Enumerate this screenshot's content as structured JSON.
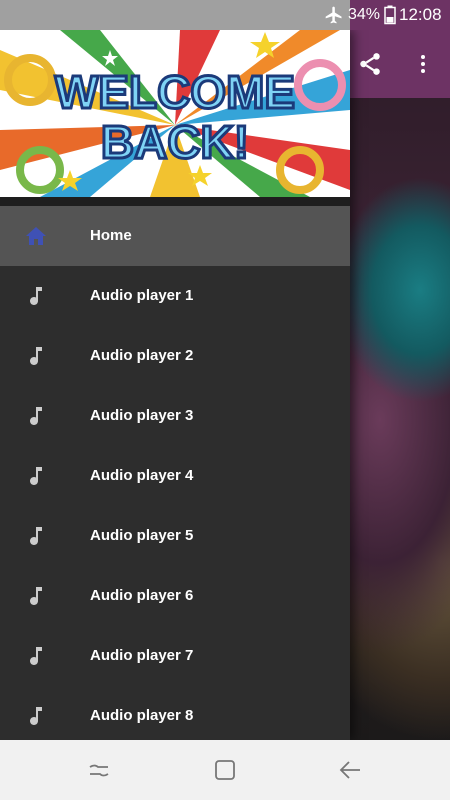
{
  "status_bar": {
    "battery": "34%",
    "time": "12:08"
  },
  "header": {
    "banner_text": [
      "WELCOME",
      "BACK!"
    ]
  },
  "drawer": {
    "items": [
      {
        "label": "Home",
        "icon": "home-icon",
        "active": true
      },
      {
        "label": "Audio player 1",
        "icon": "music-note-icon",
        "active": false
      },
      {
        "label": "Audio player 2",
        "icon": "music-note-icon",
        "active": false
      },
      {
        "label": "Audio player 3",
        "icon": "music-note-icon",
        "active": false
      },
      {
        "label": "Audio player 4",
        "icon": "music-note-icon",
        "active": false
      },
      {
        "label": "Audio player 5",
        "icon": "music-note-icon",
        "active": false
      },
      {
        "label": "Audio player 6",
        "icon": "music-note-icon",
        "active": false
      },
      {
        "label": "Audio player 7",
        "icon": "music-note-icon",
        "active": false
      },
      {
        "label": "Audio player 8",
        "icon": "music-note-icon",
        "active": false
      }
    ]
  },
  "colors": {
    "toolbar": "#6d3364",
    "drawer_bg": "#2d2d2d",
    "active_item": "#545454",
    "home_icon": "#3f51b5",
    "note_icon": "#cccccc"
  }
}
